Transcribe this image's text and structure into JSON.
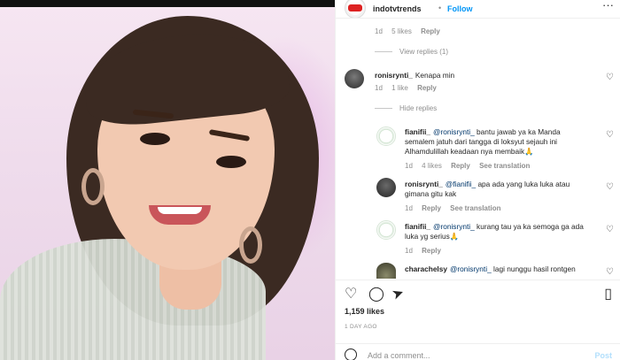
{
  "header": {
    "username": "indotvtrends",
    "follow_label": "Follow",
    "more_icon": "more-horizontal-icon"
  },
  "top_comment_meta": {
    "time": "1d",
    "likes": "5 likes",
    "reply": "Reply"
  },
  "view_replies": "View replies (1)",
  "comments": [
    {
      "user": "ronisrynti_",
      "text": "Kenapa min",
      "time": "1d",
      "likes": "1 like",
      "reply": "Reply"
    }
  ],
  "hide_replies": "Hide replies",
  "replies": [
    {
      "user": "fianifii_",
      "mention": "@ronisrynti_",
      "text1": " bantu jawab ya ka Manda",
      "text2": "semalem jatuh dari tangga di loksyut sejauh ini",
      "text3": "Alhamdulillah keadaan nya membaik🙏",
      "time": "1d",
      "likes": "4 likes",
      "reply": "Reply",
      "translate": "See translation"
    },
    {
      "user": "ronisrynti_",
      "mention": "@fianifii_",
      "text1": " apa ada yang luka luka atau",
      "text2": "gimana gitu kak",
      "time": "1d",
      "reply": "Reply",
      "translate": "See translation"
    },
    {
      "user": "fianifii_",
      "mention": "@ronisrynti_",
      "text1": " kurang tau ya ka semoga ga ada",
      "text2": "luka yg serius🙏",
      "time": "1d",
      "reply": "Reply"
    },
    {
      "user": "charachelsy",
      "mention": "@ronisrynti_",
      "text1": " lagi nunggu hasil rontgen"
    }
  ],
  "likes_count": "1,159 likes",
  "time_ago": "1 DAY AGO",
  "add_comment": {
    "placeholder": "Add a comment...",
    "post_label": "Post"
  }
}
